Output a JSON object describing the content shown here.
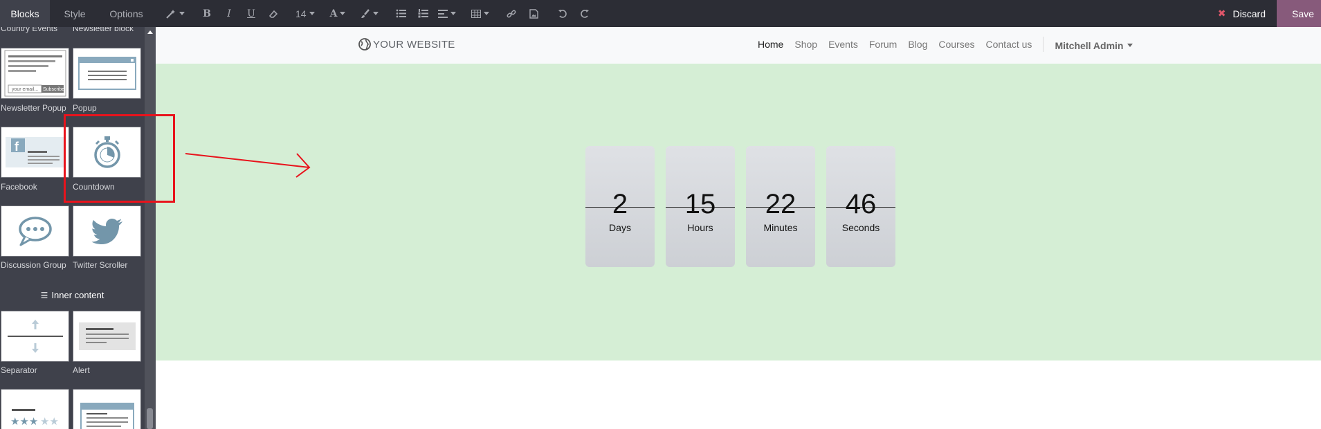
{
  "toolbar": {
    "tabs": [
      {
        "label": "Blocks",
        "active": true
      },
      {
        "label": "Style",
        "active": false
      },
      {
        "label": "Options",
        "active": false
      }
    ],
    "font_size": "14",
    "discard_label": "Discard",
    "save_label": "Save",
    "accent_color": "#875a7b"
  },
  "sidebar": {
    "top_labels": [
      "Country Events",
      "Newsletter block"
    ],
    "snippets": [
      {
        "label": "Newsletter Popup",
        "icon": "newsletter-popup-icon",
        "placeholder": "your email...",
        "button": "Subscribe"
      },
      {
        "label": "Popup",
        "icon": "popup-icon"
      },
      {
        "label": "Facebook",
        "icon": "facebook-icon"
      },
      {
        "label": "Countdown",
        "icon": "stopwatch-icon"
      },
      {
        "label": "Discussion Group",
        "icon": "chat-bubble-icon"
      },
      {
        "label": "Twitter Scroller",
        "icon": "twitter-icon"
      },
      {
        "label": "Separator",
        "icon": "separator-icon"
      },
      {
        "label": "Alert",
        "icon": "alert-icon"
      }
    ],
    "section_title": "Inner content"
  },
  "website": {
    "logo": "YOUR WEBSITE",
    "menu": [
      "Home",
      "Shop",
      "Events",
      "Forum",
      "Blog",
      "Courses",
      "Contact us"
    ],
    "user": "Mitchell Admin"
  },
  "countdown": [
    {
      "value": "2",
      "label": "Days"
    },
    {
      "value": "15",
      "label": "Hours"
    },
    {
      "value": "22",
      "label": "Minutes"
    },
    {
      "value": "46",
      "label": "Seconds"
    }
  ]
}
